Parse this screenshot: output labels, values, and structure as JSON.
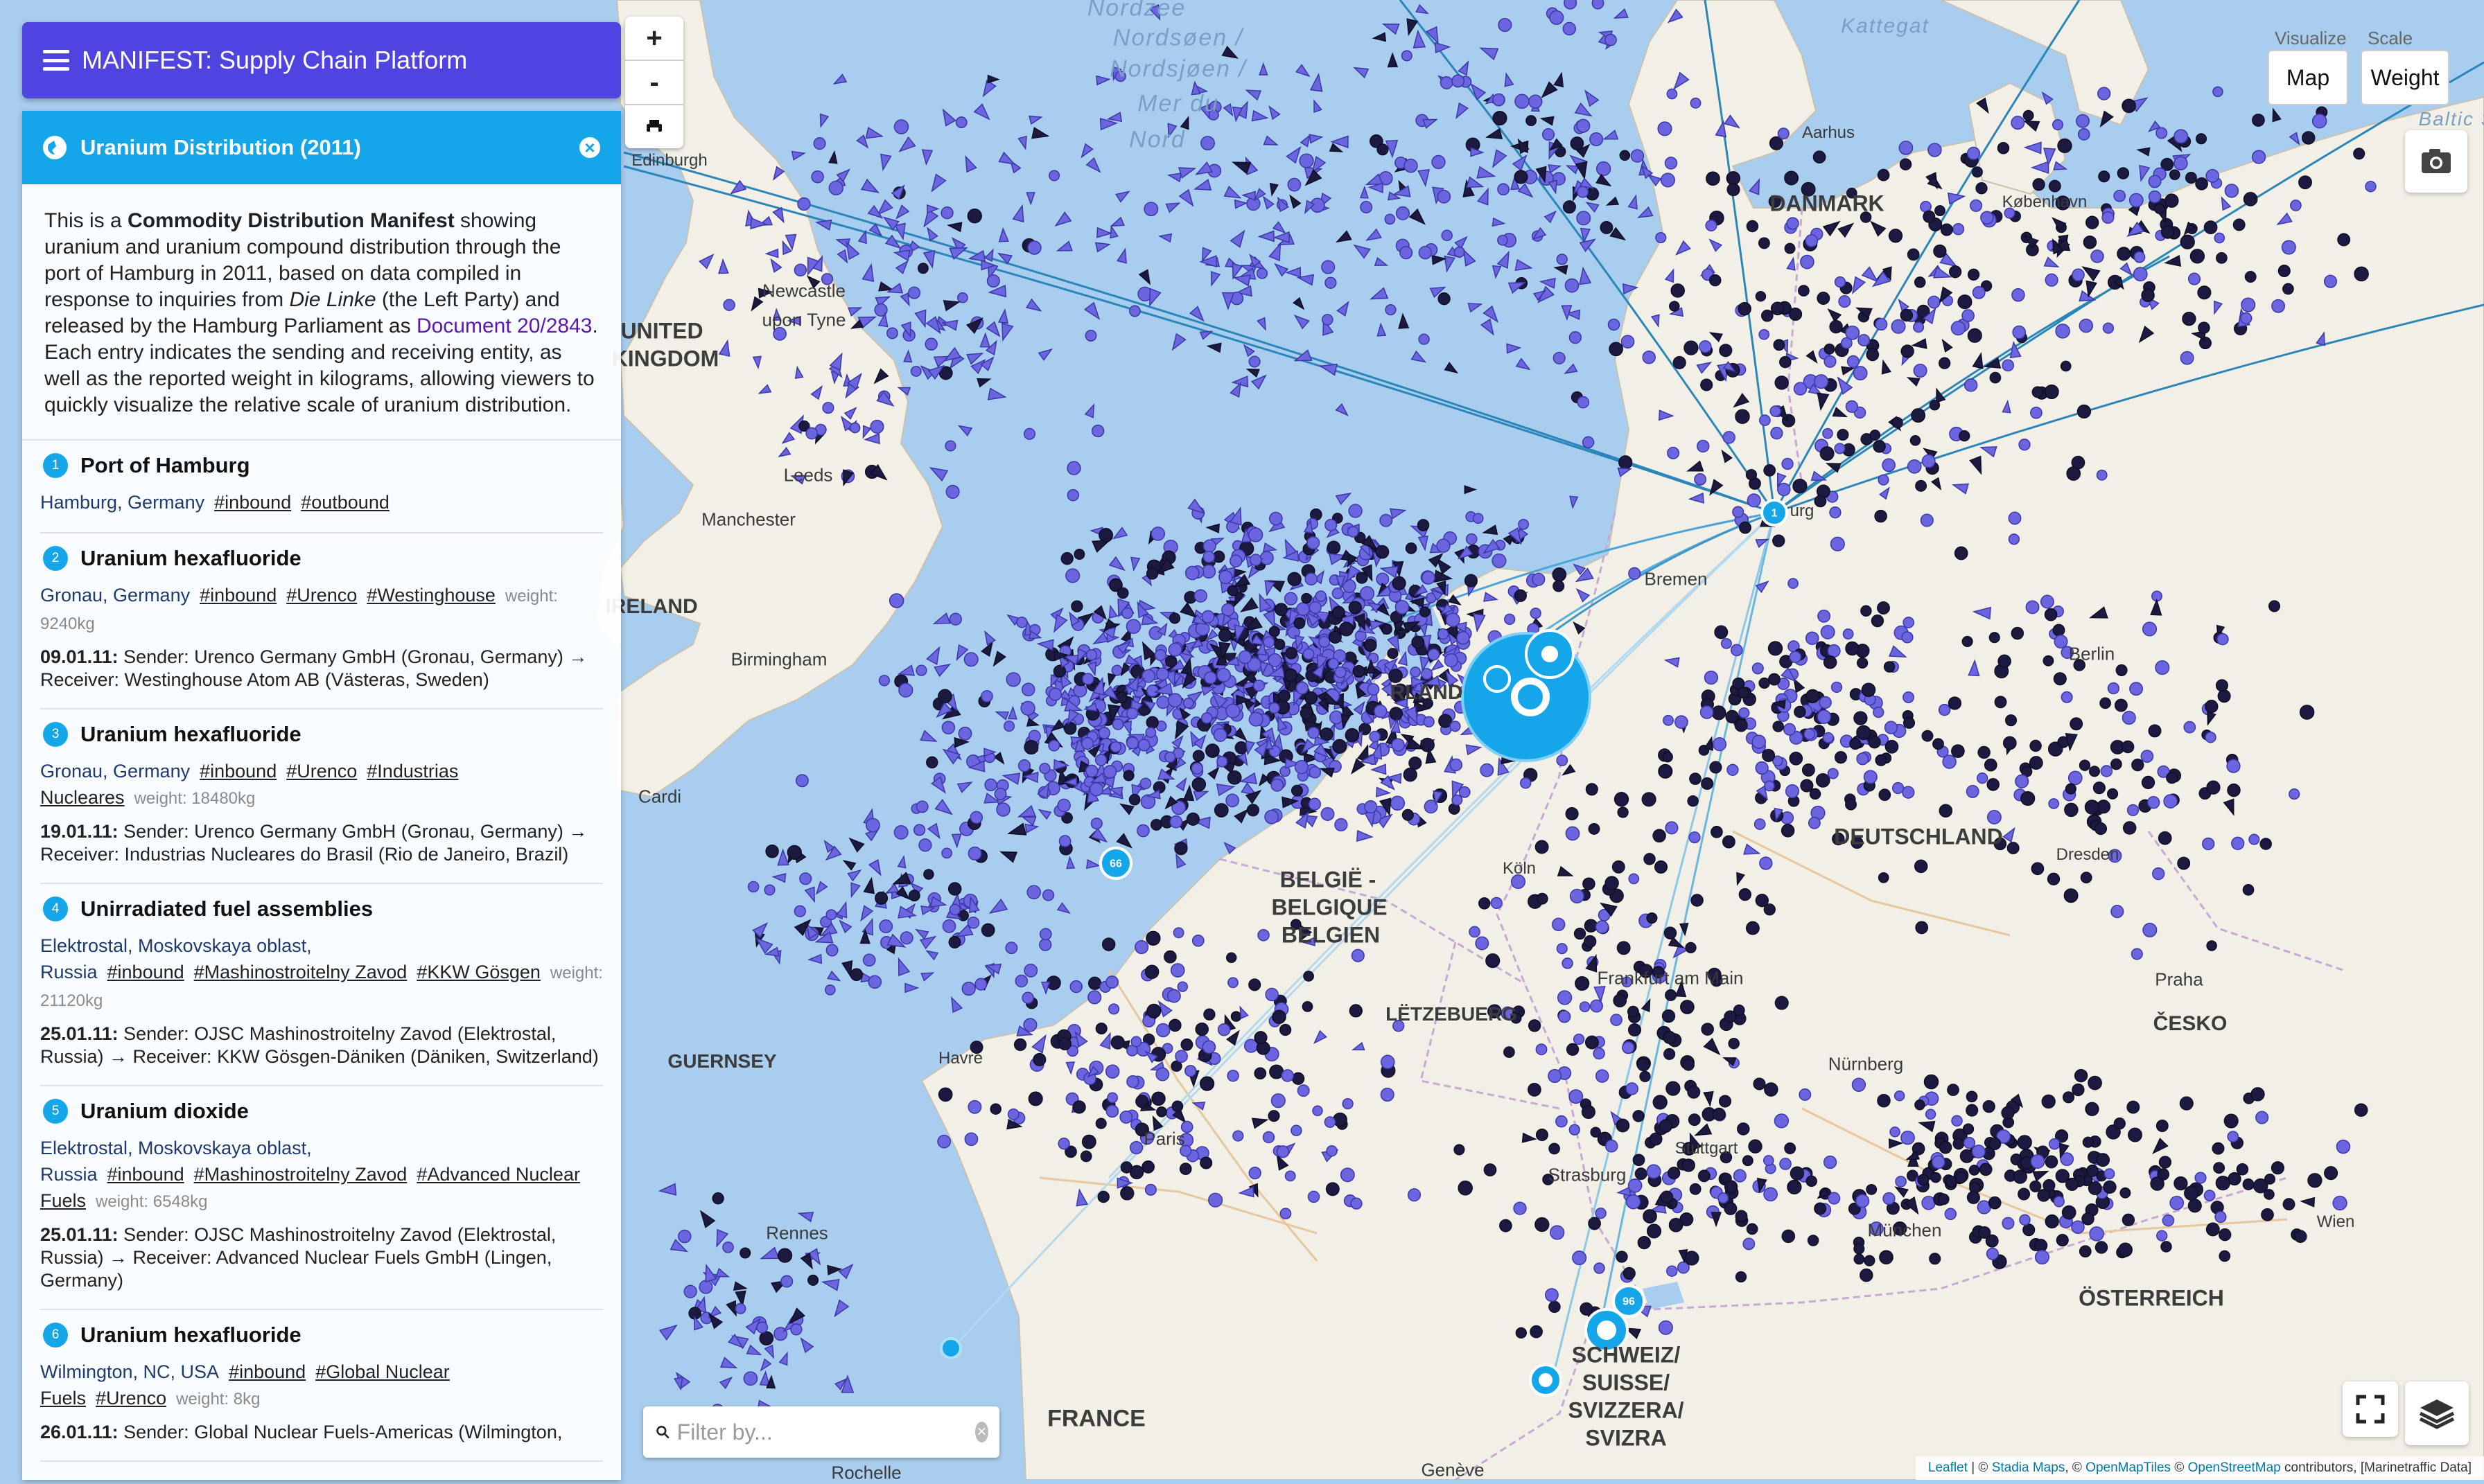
{
  "app": {
    "title": "MANIFEST: Supply Chain Platform"
  },
  "panel": {
    "title": "Uranium Distribution (2011)",
    "desc": {
      "p1": "This is a ",
      "b1": "Commodity Distribution Manifest",
      "p2": " showing uranium and uranium compound distribution through the port of Hamburg in 2011, based on data compiled in response to inquiries from ",
      "i1": "Die Linke",
      "p3": " (the Left Party) and released by the Hamburg Parliament as ",
      "link": "Document 20/2843",
      "p4": ". Each entry indicates the sending and receiving entity, as well as the reported weight in kilograms, allowing viewers to quickly visualize the relative scale of uranium distribution."
    },
    "entries": [
      {
        "num": "1",
        "title": "Port of Hamburg",
        "location": "Hamburg, Germany",
        "tags": [
          "#inbound",
          "#outbound"
        ]
      },
      {
        "num": "2",
        "title": "Uranium hexafluoride",
        "location": "Gronau, Germany",
        "tags": [
          "#inbound",
          "#Urenco",
          "#Westinghouse"
        ],
        "weight": "weight: 9240kg",
        "date": "09.01.11:",
        "shipment": " Sender: Urenco Germany GmbH (Gronau, Germany) → Receiver: Westinghouse Atom AB (Västeras, Sweden)"
      },
      {
        "num": "3",
        "title": "Uranium hexafluoride",
        "location": "Gronau, Germany",
        "tags": [
          "#inbound",
          "#Urenco",
          "#Industrias Nucleares"
        ],
        "weight": "weight: 18480kg",
        "date": "19.01.11:",
        "shipment": " Sender: Urenco Germany GmbH (Gronau, Germany) → Receiver: Industrias Nucleares do Brasil (Rio de Janeiro, Brazil)"
      },
      {
        "num": "4",
        "title": "Unirradiated fuel assemblies",
        "location": "Elektrostal, Moskovskaya oblast, Russia",
        "tags": [
          "#inbound",
          "#Mashinostroitelny Zavod",
          "#KKW Gösgen"
        ],
        "weight": "weight: 21120kg",
        "date": "25.01.11:",
        "shipment": " Sender: OJSC Mashinostroitelny Zavod (Elektrostal, Russia) → Receiver: KKW Gösgen-Däniken (Däniken, Switzerland)"
      },
      {
        "num": "5",
        "title": "Uranium dioxide",
        "location": "Elektrostal, Moskovskaya oblast, Russia",
        "tags": [
          "#inbound",
          "#Mashinostroitelny Zavod",
          "#Advanced Nuclear Fuels"
        ],
        "weight": "weight: 6548kg",
        "date": "25.01.11:",
        "shipment": " Sender: OJSC Mashinostroitelny Zavod (Elektrostal, Russia) → Receiver: Advanced Nuclear Fuels GmbH (Lingen, Germany)"
      },
      {
        "num": "6",
        "title": "Uranium hexafluoride",
        "location": "Wilmington, NC, USA",
        "tags": [
          "#inbound",
          "#Global Nuclear Fuels",
          "#Urenco"
        ],
        "weight": "weight: 8kg",
        "date": "26.01.11:",
        "shipment": " Sender: Global Nuclear Fuels-Americas (Wilmington,"
      }
    ]
  },
  "zoom": {
    "in": "+",
    "out": "-"
  },
  "controls": {
    "visualize_label": "Visualize",
    "visualize_value": "Map",
    "scale_label": "Scale",
    "scale_value": "Weight"
  },
  "filter": {
    "placeholder": "Filter by..."
  },
  "markers": {
    "hamburg": "1",
    "belgium": "66",
    "swiss": "96"
  },
  "attribution": {
    "leaflet": "Leaflet",
    "sep1": " | © ",
    "stadia": "Stadia Maps",
    "sep2": ", © ",
    "omt": "OpenMapTiles",
    "sep3": " © ",
    "osm": "OpenStreetMap",
    "tail": " contributors, [Marinetraffic Data]"
  },
  "places": {
    "sea_north": "Nordsjøen /",
    "sea_north2": "Mer du",
    "sea_north3": "Nord",
    "sea_north4": "Nordzee",
    "sea_north5": "Nordsøen /",
    "kattegat": "Kattegat",
    "baltic": "Baltic S",
    "edinburgh": "Edinburgh",
    "newcastle": "Newcastle",
    "upontyne": "upon Tyne",
    "united": "UNITED",
    "kingdom": "KINGDOM",
    "leeds": "Leeds",
    "manchester": "Manchester",
    "ireland": "IRELAND",
    "birmingham": "Birmingham",
    "cardiff": "Cardi",
    "aarhus": "Aarhus",
    "danmark": "DANMARK",
    "kobenhavn": "København",
    "hamburg": "urg",
    "bremen": "Bremen",
    "berlin": "Berlin",
    "nederland": "RLAND",
    "deutschland": "DEUTSCHLAND",
    "dresden": "Dresden",
    "belgie1": "BELGIË -",
    "belgie2": "BELGIQUE",
    "belgie3": "BELGIEN",
    "koln": "Köln",
    "letzebuerg": "LËTZEBUERG",
    "frankfurt": "Frankfurt am Main",
    "praha": "Praha",
    "cesko": "ČESKO",
    "nurnberg": "Nürnberg",
    "guernsey": "GUERNSEY",
    "havre": "Havre",
    "paris": "Paris",
    "rennes": "Rennes",
    "strasbourg": "Strasburg",
    "stuttgart": "Stuttgart",
    "munchen": "München",
    "wien": "Wien",
    "osterreich": "ÖSTERREICH",
    "france": "FRANCE",
    "schweiz1": "SCHWEIZ/",
    "schweiz2": "SUISSE/",
    "schweiz3": "SVIZZERA/",
    "schweiz4": "SVIZRA",
    "geneve": "Genève",
    "rochelle": "Rochelle"
  },
  "colors": {
    "primary": "#4f44e0",
    "accent": "#14a6e8",
    "ship": "#6b66e0",
    "ship_dark": "#1c1a40",
    "water": "#a9cdee",
    "land": "#f2efe6"
  },
  "icons": {
    "menu": "hamburger-icon",
    "globe": "globe-icon",
    "close": "close-circle-icon",
    "camera": "camera-icon",
    "search": "search-icon",
    "fullscreen": "fullscreen-icon",
    "layers": "layers-icon",
    "print": "printer-icon"
  }
}
